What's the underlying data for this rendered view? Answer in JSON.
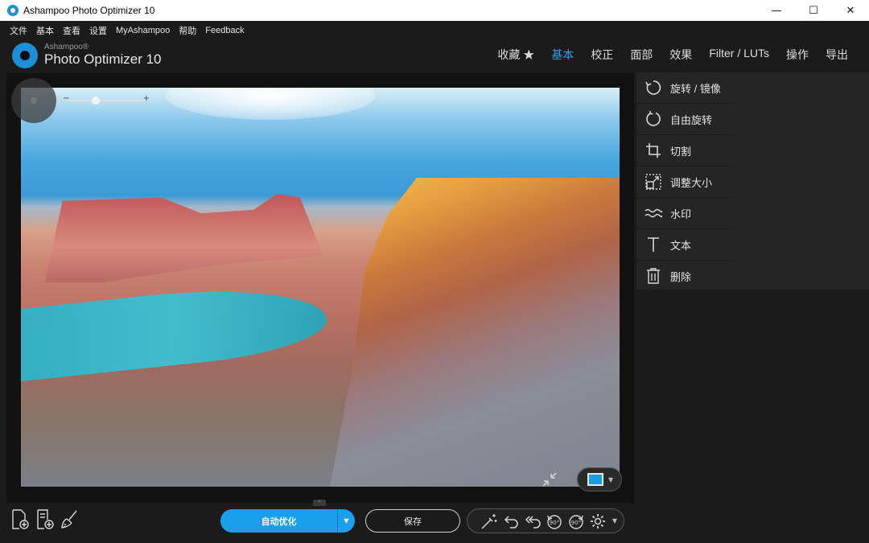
{
  "window": {
    "title": "Ashampoo Photo Optimizer 10",
    "minimize": "—",
    "maximize": "☐",
    "close": "✕"
  },
  "menu": [
    "文件",
    "基本",
    "查看",
    "设置",
    "MyAshampoo",
    "帮助",
    "Feedback"
  ],
  "logo": {
    "brand": "Ashampoo®",
    "product": "Photo Optimizer 10"
  },
  "tabs": [
    {
      "label": "收藏 ★",
      "active": false
    },
    {
      "label": "基本",
      "active": true
    },
    {
      "label": "校正",
      "active": false
    },
    {
      "label": "面部",
      "active": false
    },
    {
      "label": "效果",
      "active": false
    },
    {
      "label": "Filter / LUTs",
      "active": false
    },
    {
      "label": "操作",
      "active": false
    },
    {
      "label": "导出",
      "active": false
    }
  ],
  "zoom": {
    "minus": "−",
    "plus": "+",
    "level": 0.35
  },
  "side_panel": [
    {
      "label": "旋转 / 镜像",
      "icon": "rotate-mirror-icon"
    },
    {
      "label": "自由旋转",
      "icon": "free-rotate-icon"
    },
    {
      "label": "切割",
      "icon": "crop-icon"
    },
    {
      "label": "调整大小",
      "icon": "resize-icon"
    },
    {
      "label": "水印",
      "icon": "watermark-icon"
    },
    {
      "label": "文本",
      "icon": "text-icon"
    },
    {
      "label": "删除",
      "icon": "delete-icon"
    }
  ],
  "bottom": {
    "auto_optimize": "自动优化",
    "save": "保存",
    "rotate_left_label": "90°",
    "rotate_right_label": "90°"
  },
  "colors": {
    "accent": "#1aa0ea",
    "active_tab": "#2ba3ec",
    "background": "#1b1b1b"
  }
}
